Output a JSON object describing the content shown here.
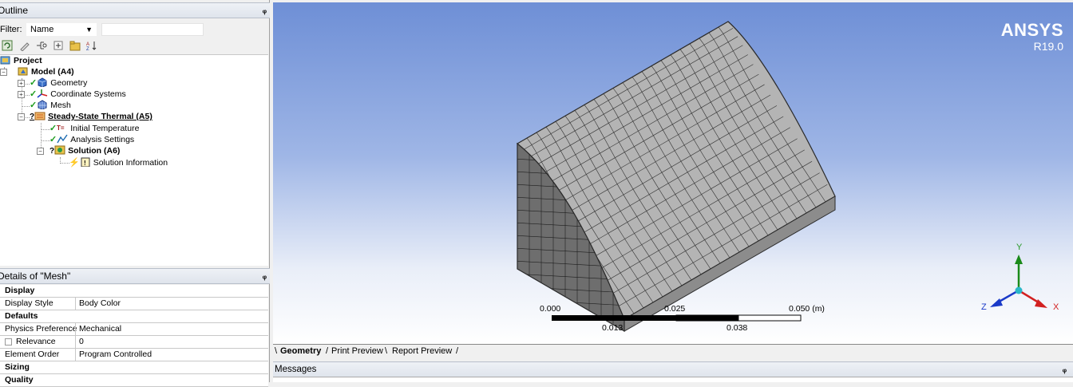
{
  "outline": {
    "title": "Outline",
    "filter_label": "Filter:",
    "filter_value": "Name",
    "filter_search": ""
  },
  "tree": [
    {
      "label": "Project"
    },
    {
      "label": "Model (A4)"
    },
    {
      "label": "Geometry"
    },
    {
      "label": "Coordinate Systems"
    },
    {
      "label": "Mesh"
    },
    {
      "label": "Steady-State Thermal (A5)"
    },
    {
      "label": "Initial Temperature"
    },
    {
      "label": "Analysis Settings"
    },
    {
      "label": "Solution (A6)"
    },
    {
      "label": "Solution Information"
    }
  ],
  "details": {
    "title": "Details of \"Mesh\"",
    "rows": [
      {
        "section": "Display"
      },
      {
        "key": "Display Style",
        "value": "Body Color"
      },
      {
        "section": "Defaults"
      },
      {
        "key": "Physics Preference",
        "value": "Mechanical"
      },
      {
        "key": "Relevance",
        "value": "0"
      },
      {
        "key": "Element Order",
        "value": "Program Controlled"
      },
      {
        "section": "Sizing"
      },
      {
        "section": "Quality"
      }
    ]
  },
  "viewport": {
    "logo": "ANSYS",
    "version": "R19.0",
    "scale": {
      "top_labels": [
        "0.000",
        "0.025",
        "0.050 (m)"
      ],
      "bottom_labels": [
        "0.013",
        "0.038"
      ]
    },
    "triad": {
      "x": "X",
      "y": "Y",
      "z": "Z"
    }
  },
  "tabs": [
    "Geometry",
    "Print Preview",
    "Report Preview"
  ],
  "messages": {
    "title": "Messages"
  },
  "colors": {
    "accent_check": "#1a9a1a",
    "viewport_top": "#6e8fd6",
    "viewport_bottom": "#ffffff",
    "mesh_face": "#b9b9b9",
    "axis_x": "#d22020",
    "axis_y": "#1a8a1a",
    "axis_z": "#1a3ac8"
  }
}
